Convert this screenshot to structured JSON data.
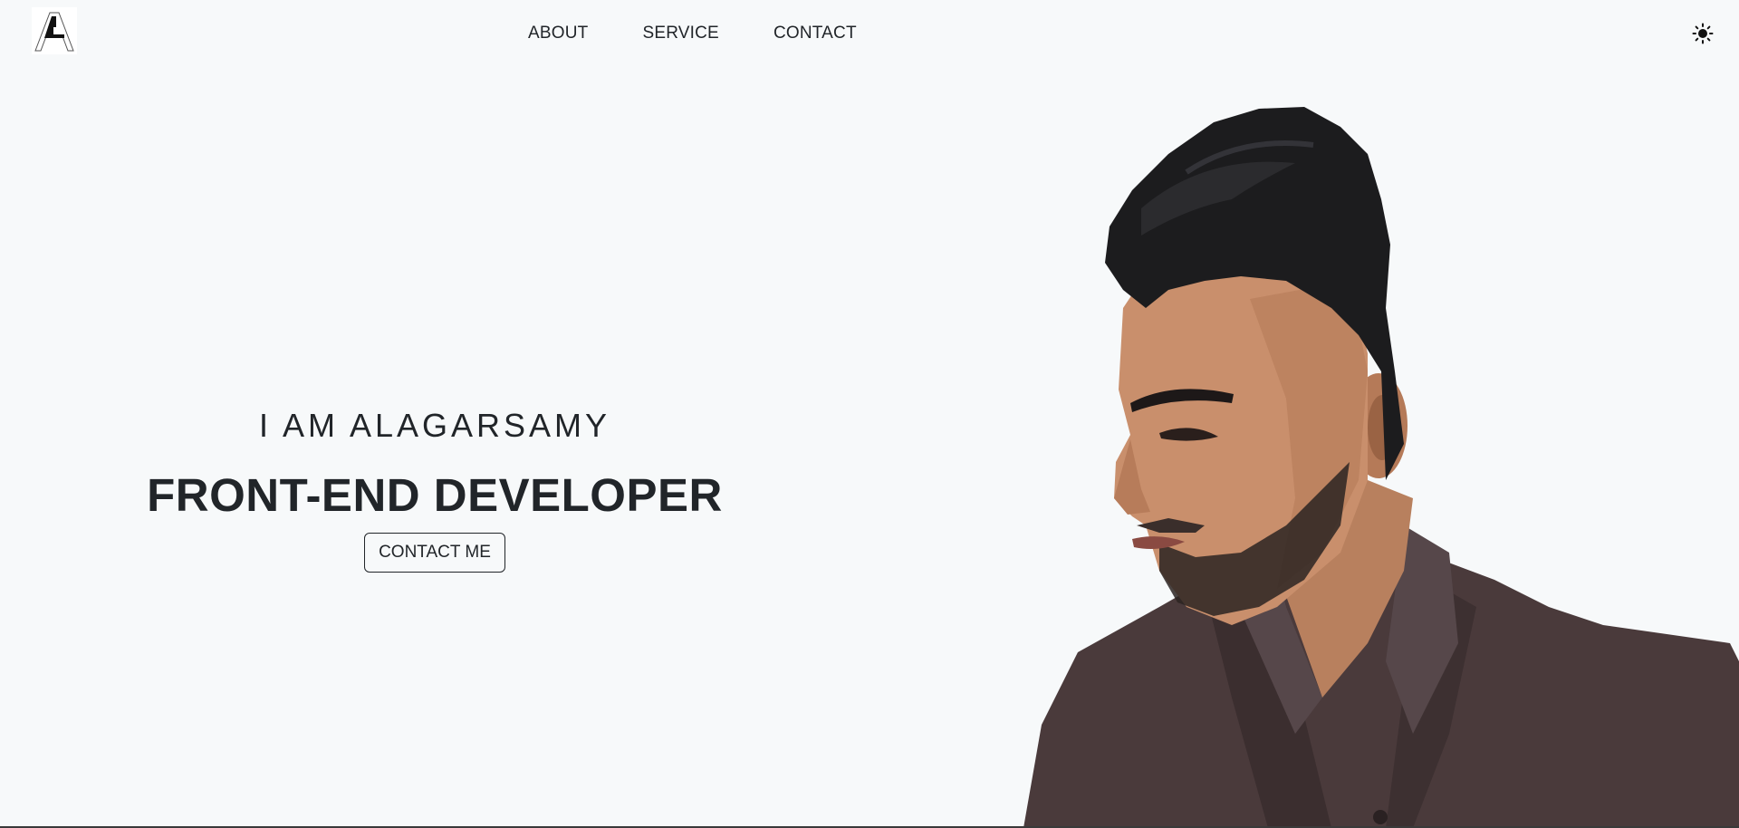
{
  "logo": {
    "alt": "AL monogram logo"
  },
  "nav": {
    "items": [
      {
        "label": "ABOUT"
      },
      {
        "label": "SERVICE"
      },
      {
        "label": "CONTACT"
      }
    ]
  },
  "theme_toggle": {
    "icon": "sun-icon"
  },
  "hero": {
    "subtitle": "I AM ALAGARSAMY",
    "title": "FRONT-END DEVELOPER",
    "cta_label": "CONTACT ME"
  },
  "portrait": {
    "icon": "portrait-photo"
  },
  "colors": {
    "background": "#f7f9fa",
    "text": "#212529",
    "hair": "#1c1c1e",
    "skin": "#c98f6c",
    "shirt": "#4a3a3b"
  }
}
